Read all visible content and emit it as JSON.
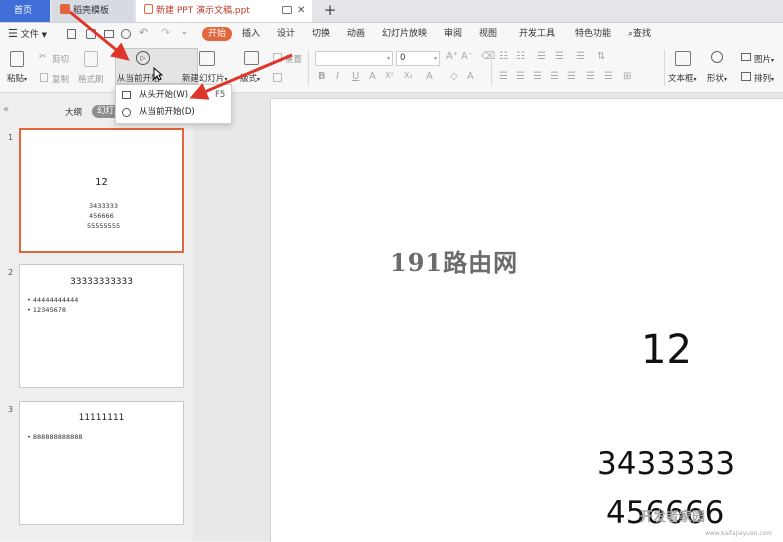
{
  "tabs": {
    "home": "首页",
    "template": "稻壳模板",
    "document": "新建 PPT 演示文稿.ppt",
    "add": "+"
  },
  "menu": {
    "file": "文件",
    "items": [
      "开始",
      "插入",
      "设计",
      "切换",
      "动画",
      "幻灯片放映",
      "审阅",
      "视图",
      "开发工具",
      "特色功能"
    ],
    "search": "查找"
  },
  "ribbon": {
    "paste": "粘贴",
    "cut": "剪切",
    "copy": "复制",
    "format_painter": "格式刷",
    "from_current": "从当前开始",
    "new_slide": "新建幻灯片",
    "layout": "版式",
    "reset": "重置",
    "font_size": "0",
    "textbox": "文本框",
    "shape": "形状",
    "picture": "图片",
    "arrange": "排列"
  },
  "dropdown": {
    "from_start": "从头开始(W)",
    "from_start_shortcut": "F5",
    "from_current": "从当前开始(D)"
  },
  "panel": {
    "outline_tab": "大纲",
    "slides_tab": "幻灯片"
  },
  "slides": [
    {
      "number": "1",
      "title": "12",
      "bullets": [
        "3433333",
        "456666",
        "55555555"
      ]
    },
    {
      "number": "2",
      "title": "33333333333",
      "bullets": [
        "44444444444",
        "12345678"
      ]
    },
    {
      "number": "3",
      "title": "11111111",
      "bullets": [
        "888888888888"
      ]
    }
  ],
  "editor": {
    "watermark": "191路由网",
    "title": "12",
    "line1": "3433333",
    "line2": "456666"
  },
  "corner_watermark": {
    "text": "开发者家园",
    "sub": "www.kaifajiayuan.com"
  },
  "colors": {
    "accent": "#e3653c",
    "home_tab": "#3f6fd6",
    "arrow": "#e0352b"
  }
}
